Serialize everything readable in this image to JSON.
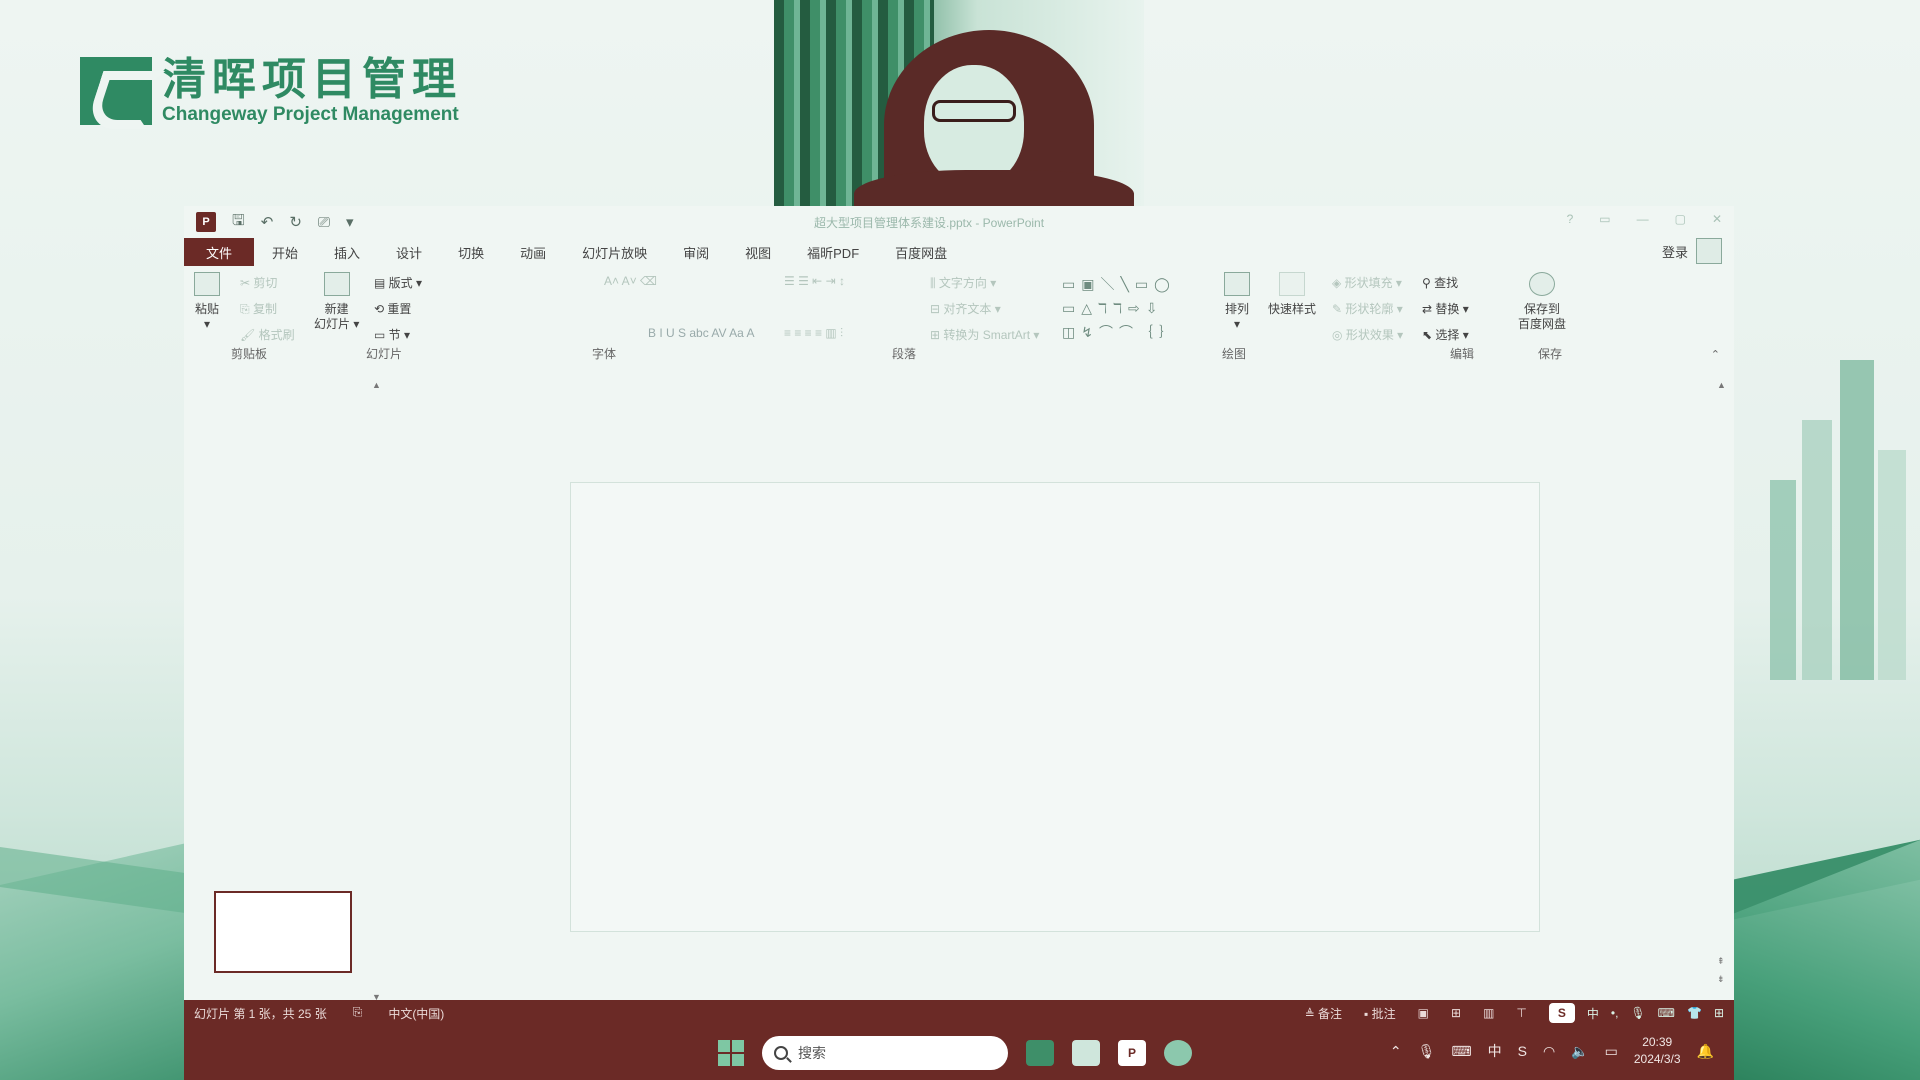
{
  "logo": {
    "cn": "清晖项目管理",
    "en": "Changeway Project Management"
  },
  "titlebar": {
    "doc_title": "超大型项目管理体系建设.pptx - PowerPoint",
    "controls": [
      "?",
      "▭",
      "—",
      "▢",
      "✕"
    ]
  },
  "tabs": [
    "文件",
    "开始",
    "插入",
    "设计",
    "切换",
    "动画",
    "幻灯片放映",
    "审阅",
    "视图",
    "福昕PDF",
    "百度网盘"
  ],
  "signin": "登录",
  "ribbon": {
    "clipboard": {
      "paste": "粘贴",
      "cut": "剪切",
      "copy": "复制",
      "format_painter": "格式刷",
      "label": "剪贴板"
    },
    "slides": {
      "new_slide_1": "新建",
      "new_slide_2": "幻灯片",
      "layout": "版式",
      "reset": "重置",
      "section": "节",
      "label": "幻灯片"
    },
    "font": {
      "label": "字体",
      "buttons": "B  I  U  S  abc  AV  Aa   A"
    },
    "paragraph": {
      "text_direction": "文字方向",
      "align_text": "对齐文本",
      "convert_smartart": "转换为 SmartArt",
      "label": "段落"
    },
    "drawing": {
      "arrange": "排列",
      "quick_styles": "快速样式",
      "shape_fill": "形状填充",
      "shape_outline": "形状轮廓",
      "shape_effects": "形状效果",
      "label": "绘图",
      "shapes": "▭▣＼╲▭◯ ▭△ℸℸ⇨⇩ ◫↯⌒⌒｛｝"
    },
    "editing": {
      "find": "查找",
      "replace": "替换",
      "select": "选择",
      "label": "编辑"
    },
    "save": {
      "line1": "保存到",
      "line2": "百度网盘",
      "label": "保存"
    }
  },
  "statusbar": {
    "slide_info": "幻灯片 第 1 张，共 25 张",
    "language": "中文(中国)",
    "notes": "备注",
    "comments": "批注",
    "ime_cn": "中"
  },
  "taskbar": {
    "search_placeholder": "搜索",
    "ppt_label": "P",
    "tray_ime": "中",
    "time": "20:39",
    "date": "2024/3/3"
  }
}
